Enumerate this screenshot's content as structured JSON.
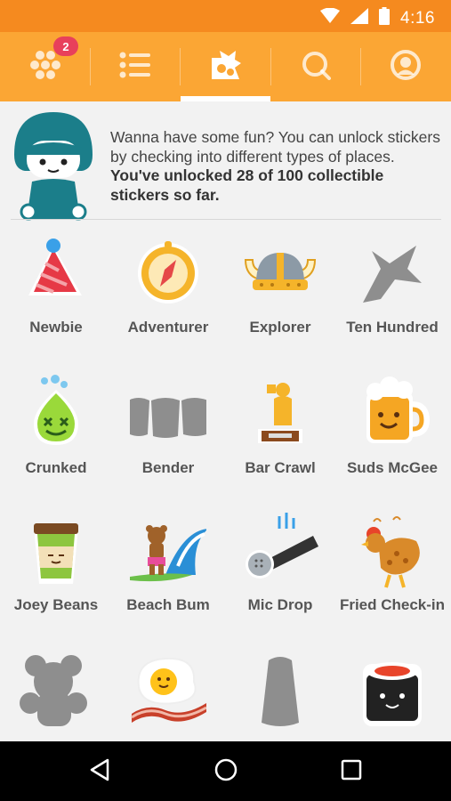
{
  "status_bar": {
    "time": "4:16",
    "icons": [
      "wifi-icon",
      "signal-icon",
      "battery-icon"
    ]
  },
  "tabs": [
    {
      "name": "stickers-tab",
      "icon": "honeycomb-icon",
      "badge": "2"
    },
    {
      "name": "lists-tab",
      "icon": "list-icon"
    },
    {
      "name": "badges-tab",
      "icon": "sticker-icon",
      "selected": true
    },
    {
      "name": "search-tab",
      "icon": "search-icon"
    },
    {
      "name": "profile-tab",
      "icon": "profile-icon"
    }
  ],
  "intro": {
    "text_plain": "Wanna have some fun? You can unlock stickers by checking into different types of places. ",
    "text_bold": "You've unlocked 28 of 100 collectible stickers so far."
  },
  "stickers": [
    {
      "label": "Newbie",
      "icon": "party-hat-icon",
      "unlocked": true
    },
    {
      "label": "Adventurer",
      "icon": "compass-icon",
      "unlocked": true
    },
    {
      "label": "Explorer",
      "icon": "viking-helmet-icon",
      "unlocked": true
    },
    {
      "label": "Ten Hundred",
      "icon": "airplane-icon",
      "unlocked": false
    },
    {
      "label": "Crunked",
      "icon": "drunk-face-icon",
      "unlocked": true
    },
    {
      "label": "Bender",
      "icon": "shot-glasses-icon",
      "unlocked": false
    },
    {
      "label": "Bar Crawl",
      "icon": "trophy-icon",
      "unlocked": true
    },
    {
      "label": "Suds McGee",
      "icon": "beer-mug-icon",
      "unlocked": true
    },
    {
      "label": "Joey Beans",
      "icon": "coffee-cup-icon",
      "unlocked": true
    },
    {
      "label": "Beach Bum",
      "icon": "surfing-bear-icon",
      "unlocked": true
    },
    {
      "label": "Mic Drop",
      "icon": "microphone-icon",
      "unlocked": true
    },
    {
      "label": "Fried Check-in",
      "icon": "fried-chicken-icon",
      "unlocked": true
    },
    {
      "label": "",
      "icon": "teddy-bear-icon",
      "unlocked": false
    },
    {
      "label": "",
      "icon": "egg-bacon-icon",
      "unlocked": true
    },
    {
      "label": "",
      "icon": "thimble-icon",
      "unlocked": false
    },
    {
      "label": "",
      "icon": "sushi-icon",
      "unlocked": true
    }
  ],
  "nav": [
    {
      "name": "back-button",
      "icon": "back-triangle-icon"
    },
    {
      "name": "home-button",
      "icon": "home-circle-icon"
    },
    {
      "name": "recents-button",
      "icon": "recents-square-icon"
    }
  ],
  "colors": {
    "status_bar": "#f58a1f",
    "tab_bar": "#fba634",
    "badge": "#e8405b",
    "mascot": "#1b7e8a",
    "locked": "#8e8e8e"
  }
}
